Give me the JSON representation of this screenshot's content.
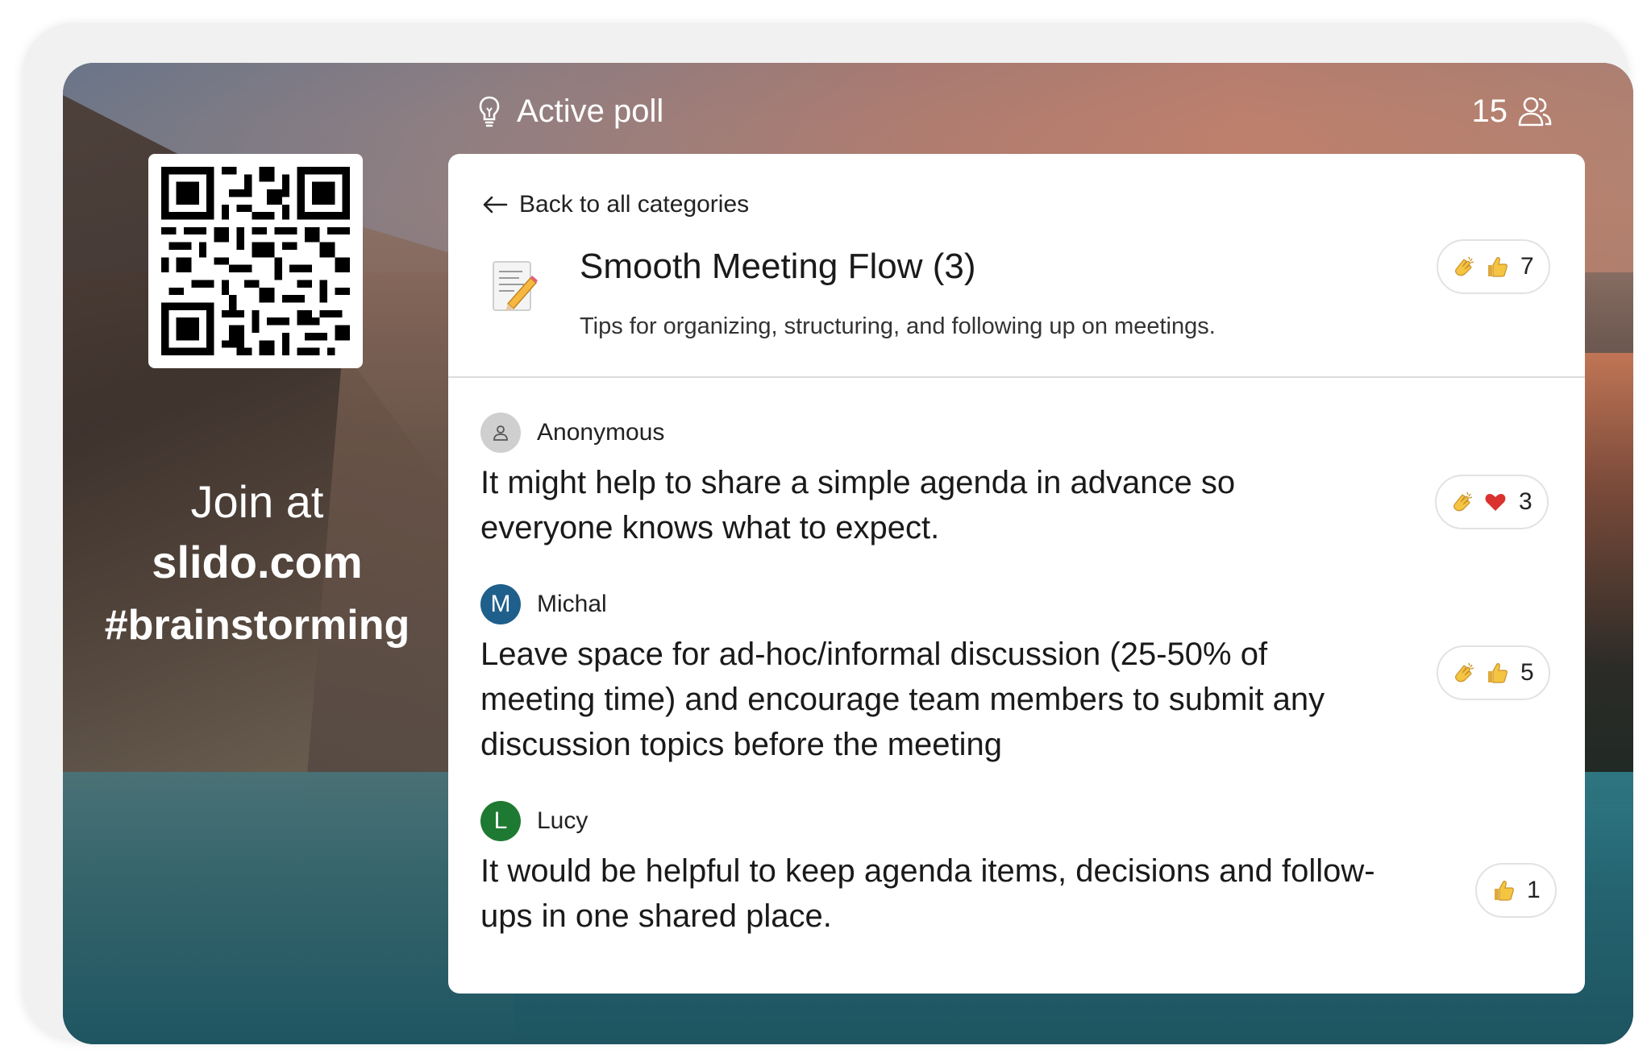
{
  "header": {
    "title": "Active poll",
    "participants": "15",
    "bulb_icon": "lightbulb-icon",
    "people_icon": "people-icon"
  },
  "join": {
    "line1": "Join at",
    "url": "slido.com",
    "code": "#brainstorming"
  },
  "card": {
    "back_label": "Back to all categories",
    "category": {
      "icon": "memo-icon",
      "title": "Smooth Meeting Flow (3)",
      "description": "Tips for organizing, structuring, and following up on meetings.",
      "reaction_count": "7"
    },
    "ideas": [
      {
        "author": "Anonymous",
        "avatar_letter": "",
        "avatar_color": "#c9c9c9",
        "text_lines": [
          "It might help to share a simple agenda in advance so",
          "everyone knows what to expect."
        ],
        "reactions": [
          "clap",
          "heart"
        ],
        "count": "3"
      },
      {
        "author": "Michal",
        "avatar_letter": "M",
        "avatar_color": "#1f5f8b",
        "text_lines": [
          "Leave space for ad-hoc/informal discussion (25-50% of",
          "meeting time) and encourage team members to submit any",
          "discussion topics before the meeting"
        ],
        "reactions": [
          "clap",
          "thumbs-up"
        ],
        "count": "5"
      },
      {
        "author": "Lucy",
        "avatar_letter": "L",
        "avatar_color": "#1e7a32",
        "text_lines": [
          "It would be helpful to keep agenda items, decisions and follow-",
          "ups in one shared place."
        ],
        "reactions": [
          "thumbs-up"
        ],
        "count": "1"
      }
    ]
  },
  "colors": {
    "card_bg": "#ffffff",
    "heart": "#d9322f",
    "emoji_yellow": "#f5c542"
  }
}
